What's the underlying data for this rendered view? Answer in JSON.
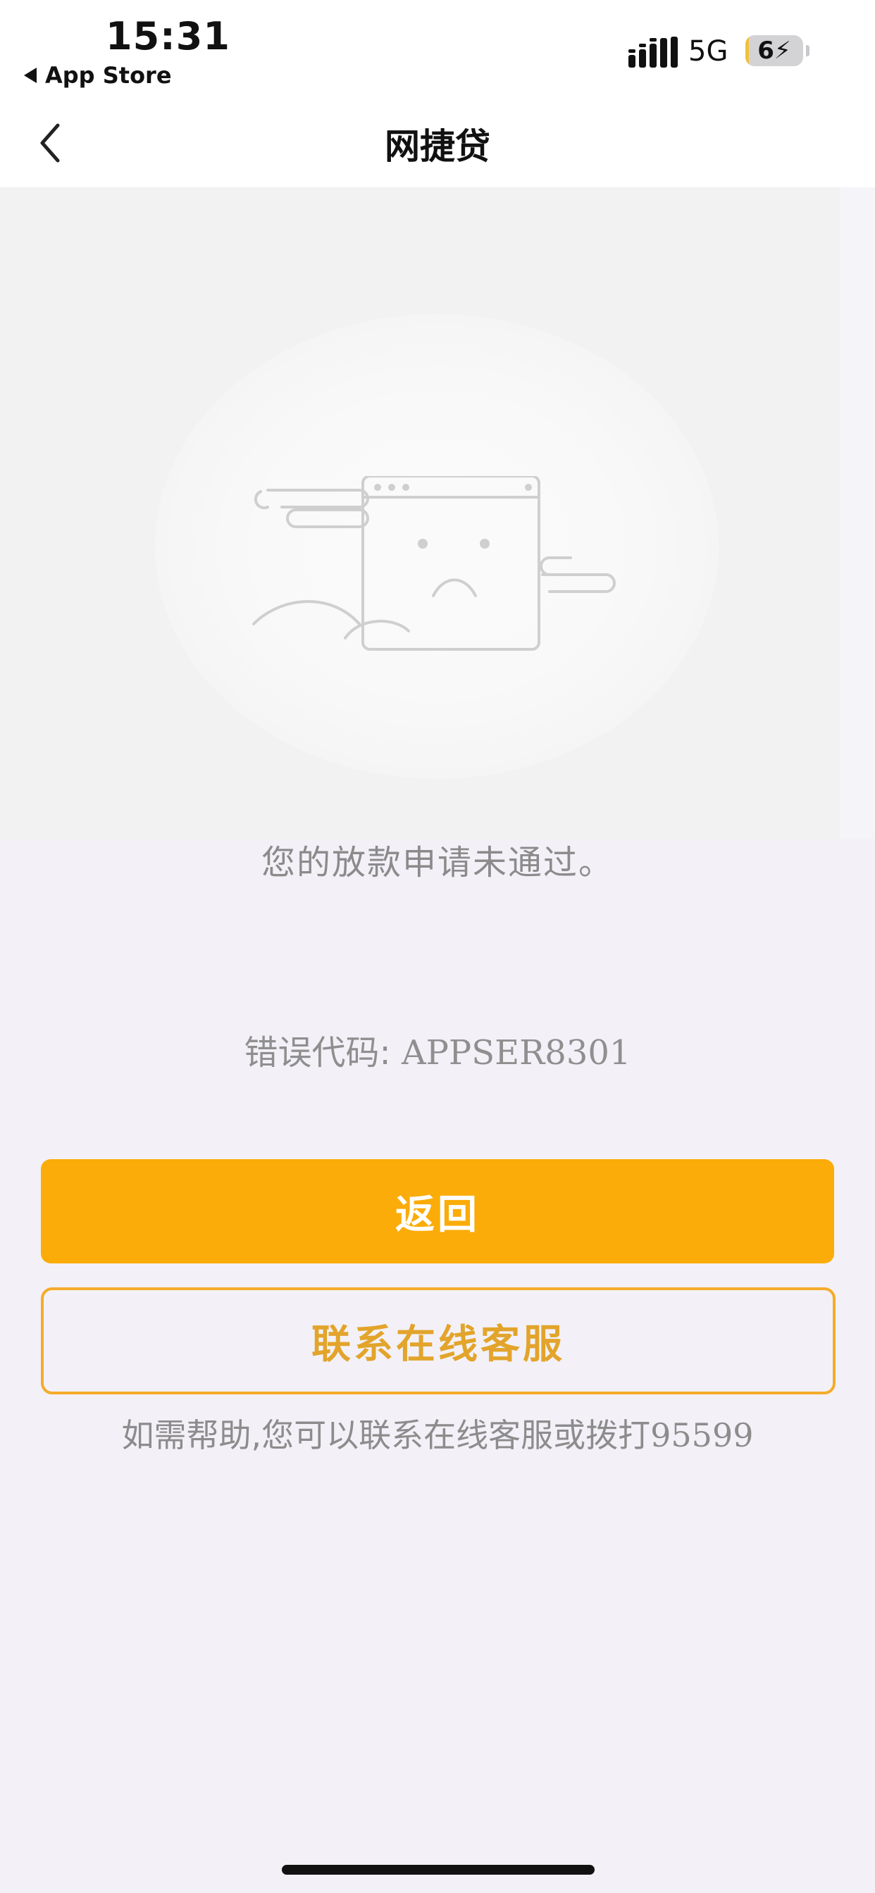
{
  "status_bar": {
    "time": "15:31",
    "back_label": "App Store",
    "network": "5G",
    "battery": "6",
    "battery_level_percent": 6,
    "icons": [
      "signal-icon",
      "battery-icon",
      "back-triangle-icon"
    ]
  },
  "nav": {
    "title": "网捷贷",
    "back_icon": "chevron-left-icon"
  },
  "illustration": {
    "icon": "sad-window-icon"
  },
  "content": {
    "message": "您的放款申请未通过。",
    "error_label": "错误代码: ",
    "error_code": "APPSER8301"
  },
  "buttons": {
    "return_label": "返回",
    "service_label": "联系在线客服"
  },
  "help": {
    "text": "如需帮助,您可以联系在线客服或拨打",
    "phone": "95599"
  },
  "colors": {
    "primary": "#fbac08",
    "outline": "#f5ab2a",
    "outline_text": "#e2a42b",
    "background": "#f3f1f7"
  }
}
